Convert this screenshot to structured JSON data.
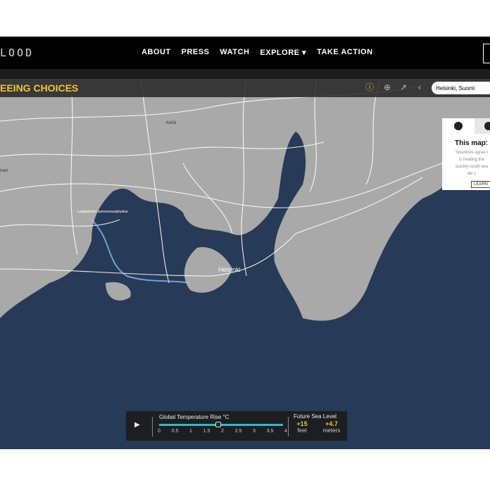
{
  "nav": {
    "logo": "LOOD",
    "items": [
      "ABOUT",
      "PRESS",
      "WATCH",
      "EXPLORE ▾",
      "TAKE ACTION"
    ]
  },
  "toolbar": {
    "title": "EEING CHOICES",
    "search_value": "Helsinki, Suomi",
    "icons": [
      "info-icon",
      "download-icon",
      "external-link-icon",
      "share-icon"
    ]
  },
  "map": {
    "labels": {
      "city": "Helsinki",
      "kehä": "Kehä",
      "west": "inen",
      "park": "Laajalahden luonnonsuojelualue"
    },
    "colors": {
      "land": "#a9a9a9",
      "water": "#273a57",
      "roads": "#ffffff",
      "accent": "#f4c430"
    }
  },
  "card": {
    "title": "This map: S",
    "body": "Scientists agree t\nis heating the\nquickly could sea\nwe s",
    "learn": "LEARN"
  },
  "controls": {
    "temp_label": "Global Temperature Rise °C",
    "ticks": [
      "0",
      "0.5",
      "1",
      "1.5",
      "2",
      "2.5",
      "3",
      "3.5",
      "4"
    ],
    "temp_value": 1.9,
    "temp_max": 4,
    "sea_label": "Future Sea Level",
    "feet": "+15",
    "feet_unit": "feet",
    "meters": "+4.7",
    "meters_unit": "meters"
  }
}
